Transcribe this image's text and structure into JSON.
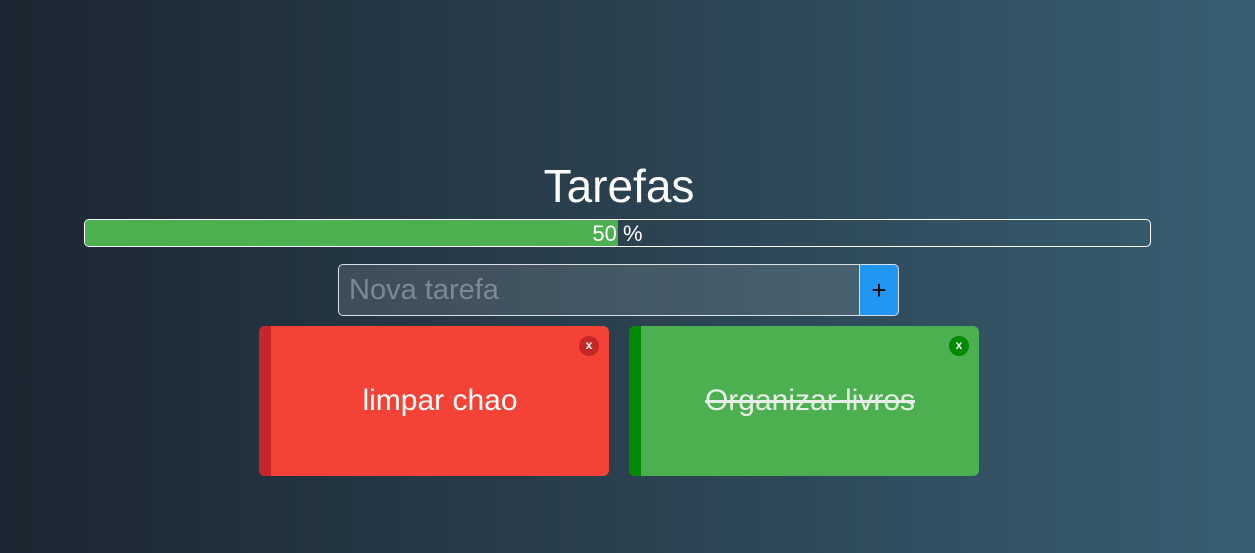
{
  "header": {
    "title": "Tarefas"
  },
  "progress": {
    "percent": 50,
    "label": "50 %",
    "fill_color": "#4caf50"
  },
  "new_task": {
    "placeholder": "Nova tarefa",
    "value": "",
    "add_label": "+"
  },
  "tasks": [
    {
      "text": "limpar chao",
      "done": false,
      "close_label": "x",
      "card_color": "#f44336",
      "strip_color": "#c62828",
      "close_color": "#c62828"
    },
    {
      "text": "Organizar livros",
      "done": true,
      "close_label": "x",
      "card_color": "#4caf50",
      "strip_color": "#008a00",
      "close_color": "#008a00"
    }
  ],
  "colors": {
    "accent": "#2196f3"
  }
}
